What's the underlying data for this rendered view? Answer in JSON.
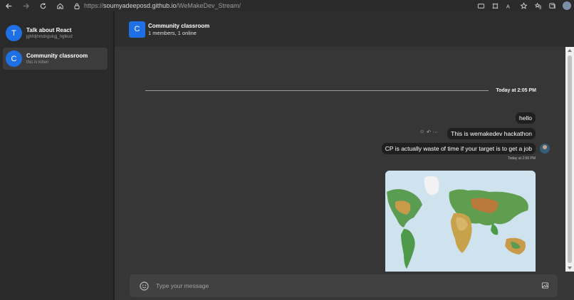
{
  "browser": {
    "url_prefix": "https://",
    "url_host": "soumyadeeposd.github.io",
    "url_path": "/WeMakeDev_Stream/"
  },
  "sidebar": {
    "channels": [
      {
        "initial": "T",
        "name": "Talk about React",
        "sub": "jghfdjhmdxgukgj_hgtkud"
      },
      {
        "initial": "C",
        "name": "Community classroom",
        "sub": "this is kitten"
      }
    ]
  },
  "header": {
    "initial": "C",
    "title": "Community classroom",
    "subtitle": "1 members, 1 online"
  },
  "messages": {
    "date_divider": "Today at 2:05 PM",
    "items": [
      {
        "text": "hello"
      },
      {
        "text": "This is wemakedev hackathon"
      },
      {
        "text": "CP is actually waste of time if your target is to get a job"
      }
    ],
    "timestamp": "Today at 2:56 PM"
  },
  "composer": {
    "placeholder": "Type your message"
  },
  "colors": {
    "accent": "#1f6fe5",
    "sidebar_bg": "#2a2a2a",
    "chat_bg": "#363636",
    "bubble_bg": "#1f1f1f"
  }
}
